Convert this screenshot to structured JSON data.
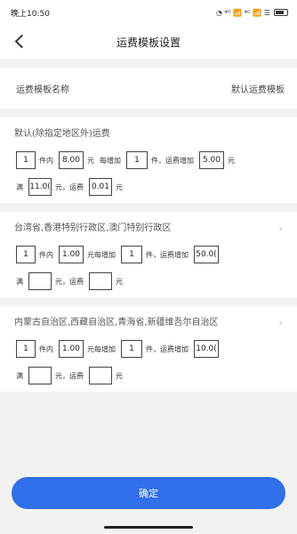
{
  "status": {
    "time": "晚上10:50",
    "icons": "◔ ⁴ᴳ 📶 ⁴ᴳ 📶 ☰"
  },
  "nav": {
    "title": "运费模板设置"
  },
  "template": {
    "label": "运费模板名称",
    "value": "默认运费模板"
  },
  "labels": {
    "pieces_within": "件内",
    "yuan": "元",
    "each_add": "每增加",
    "each_add_nospace": "元每增加",
    "piece_fee_add": "件，运费增加",
    "full": "满",
    "yuan_fee": "元，运费"
  },
  "regions": [
    {
      "title": "默认(除指定地区外)运费",
      "has_chevron": false,
      "first_qty": "1",
      "first_fee": "8.00",
      "add_qty": "1",
      "add_fee": "5.00",
      "threshold": "11.0(",
      "reduced_fee": "0.01"
    },
    {
      "title": "台湾省,香港特别行政区,澳门特别行政区",
      "has_chevron": true,
      "first_qty": "1",
      "first_fee": "1.00",
      "add_qty": "1",
      "add_fee": "50.0(",
      "threshold": "",
      "reduced_fee": ""
    },
    {
      "title": "内蒙古自治区,西藏自治区,青海省,新疆维吾尔自治区",
      "has_chevron": true,
      "first_qty": "1",
      "first_fee": "1.00",
      "add_qty": "1",
      "add_fee": "10.0(",
      "threshold": "",
      "reduced_fee": ""
    }
  ],
  "confirm": {
    "label": "确定"
  }
}
